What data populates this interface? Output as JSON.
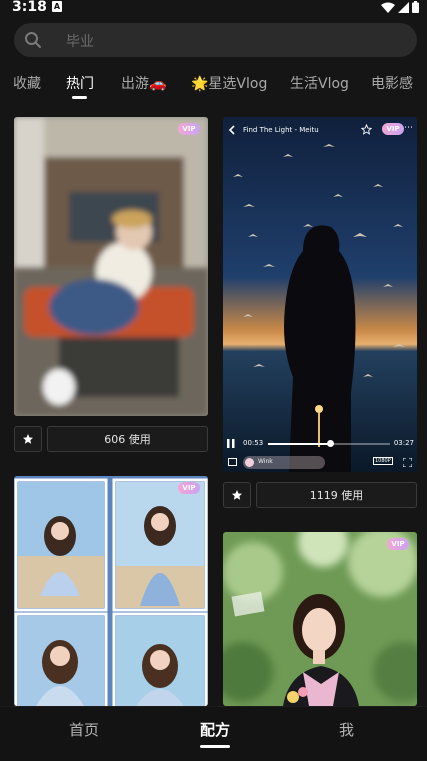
{
  "status": {
    "time": "3:18",
    "notification_letter": "A"
  },
  "search": {
    "placeholder": "毕业"
  },
  "tabs": [
    {
      "label": "收藏",
      "active": false
    },
    {
      "label": "热门",
      "active": true
    },
    {
      "label": "出游🚗",
      "active": false
    },
    {
      "label": "🌟星选Vlog",
      "active": false
    },
    {
      "label": "生活Vlog",
      "active": false
    },
    {
      "label": "电影感",
      "active": false
    }
  ],
  "cards": [
    {
      "badge": "VIP",
      "usage": "606 使用"
    },
    {
      "badge": "VIP",
      "usage": "1119 使用",
      "player": {
        "title": "Find The Light - Meitu",
        "time_current": "00:53",
        "time_total": "03:27",
        "effect_label": "Wink",
        "quality": "1080P",
        "progress": 0.51
      }
    },
    {
      "badge": "VIP"
    },
    {
      "badge": "VIP"
    }
  ],
  "bottom_nav": [
    {
      "label": "首页",
      "active": false
    },
    {
      "label": "配方",
      "active": true
    },
    {
      "label": "我",
      "active": false
    }
  ],
  "colors": {
    "background": "#151515",
    "vip_gradient_start": "#f3a6d4",
    "vip_gradient_end": "#c9a4f2",
    "active_text": "#ffffff",
    "inactive_text": "#a9a9a9"
  }
}
